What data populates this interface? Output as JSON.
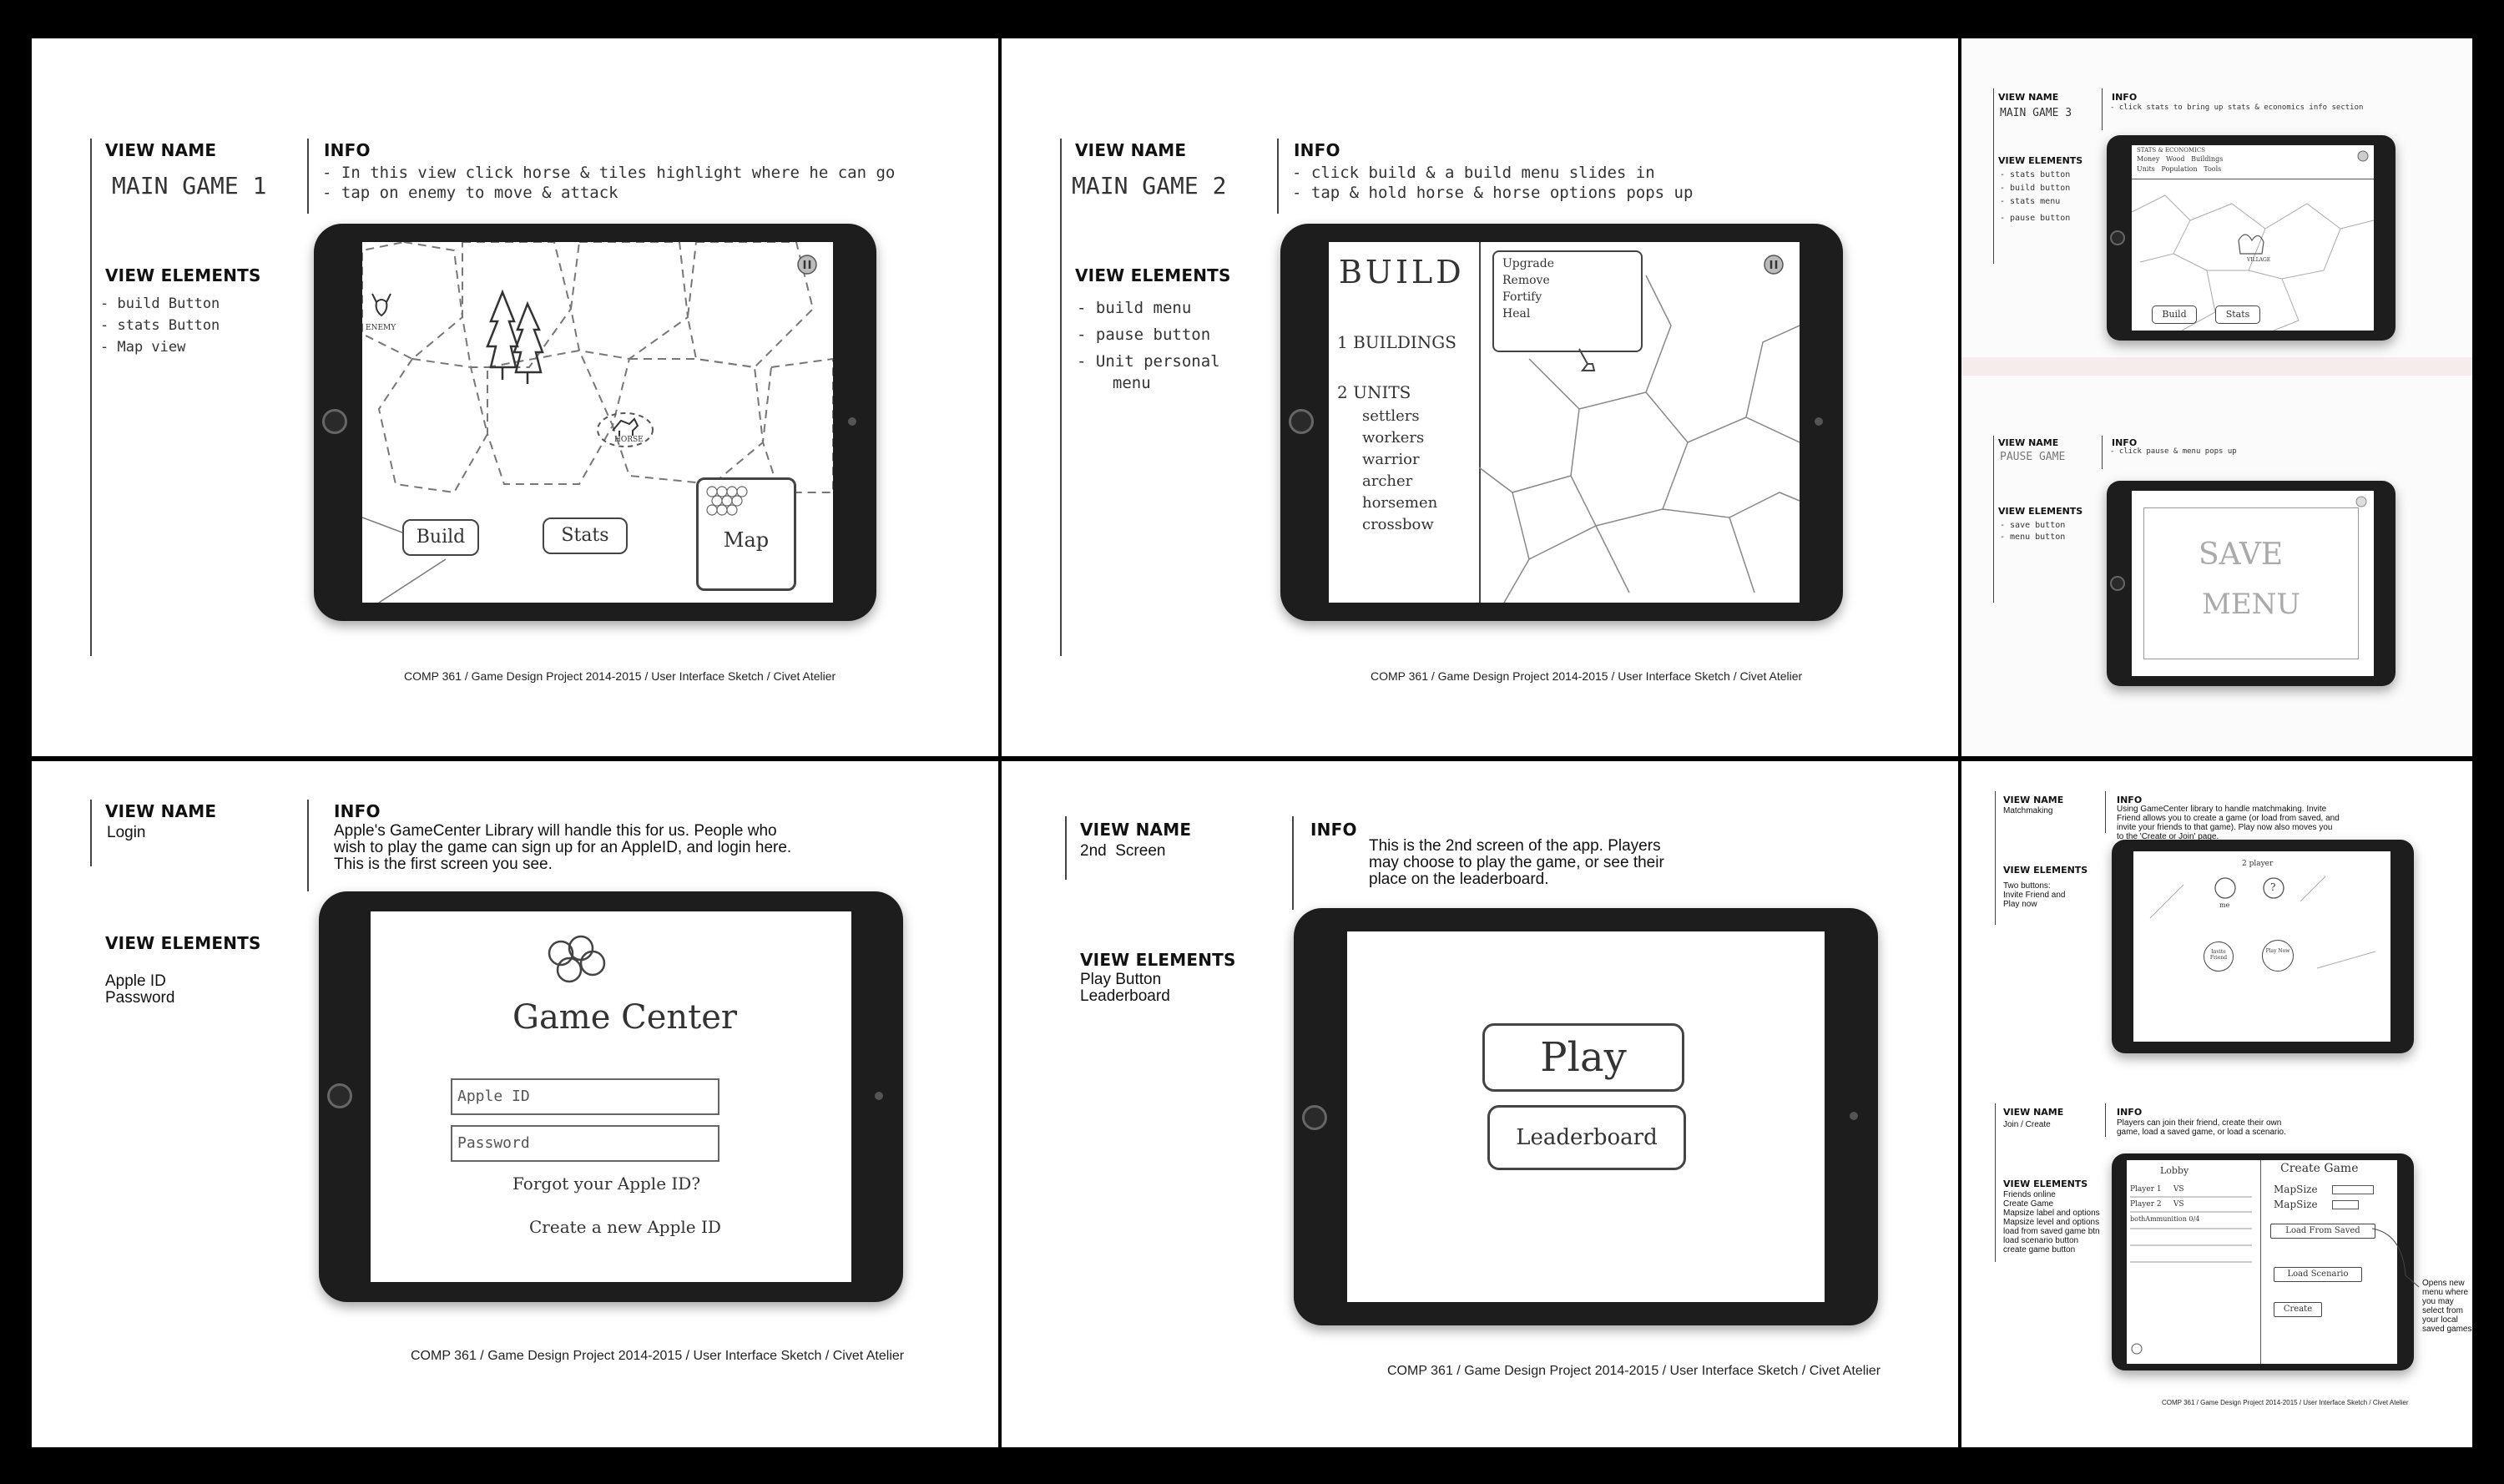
{
  "sheets": {
    "main_game_1": {
      "view_name_label": "VIEW NAME",
      "view_name": "MAIN GAME 1",
      "info_label": "INFO",
      "info_lines": [
        "- In this view click horse & tiles highlight where he can go",
        "- tap on enemy to move & attack"
      ],
      "view_elements_label": "VIEW ELEMENTS",
      "view_elements": [
        "- build Button",
        "- stats Button",
        "- Map view"
      ],
      "screen": {
        "enemy": "ENEMY",
        "horse": "HORSE",
        "build": "Build",
        "stats": "Stats",
        "map": "Map"
      },
      "footer": "COMP 361 / Game Design Project 2014-2015 / User Interface Sketch / Civet Atelier"
    },
    "main_game_2": {
      "view_name_label": "VIEW NAME",
      "view_name": "MAIN GAME 2",
      "info_label": "INFO",
      "info_lines": [
        "- click build & a build menu slides in",
        "- tap & hold horse & horse options pops up"
      ],
      "view_elements_label": "VIEW ELEMENTS",
      "view_elements": [
        "- build menu",
        "- pause button",
        "- Unit personal",
        "  menu"
      ],
      "screen": {
        "build_title": "BUILD",
        "buildings": "1 BUILDINGS",
        "units": "2 UNITS",
        "unit_list": [
          "settlers",
          "workers",
          "warrior",
          "archer",
          "horsemen",
          "crossbow"
        ],
        "popup": [
          "Upgrade",
          "Remove",
          "Fortify",
          "Heal"
        ]
      },
      "footer": "COMP 361 / Game Design Project 2014-2015 / User Interface Sketch / Civet Atelier"
    },
    "main_game_3": {
      "view_name_label": "VIEW NAME",
      "view_name": "MAIN GAME 3",
      "info_label": "INFO",
      "info_lines": [
        "- click stats to bring up stats & economics info section"
      ],
      "view_elements_label": "VIEW ELEMENTS",
      "view_elements": [
        "- stats button",
        "- build button",
        "- stats menu",
        "- pause button"
      ],
      "screen": {
        "stats_title": "STATS & ECONOMICS",
        "stats_row1": "Money   Wood   Buildings",
        "stats_row2": "Units   Population   Tools",
        "village": "VILLAGE",
        "build": "Build",
        "stats": "Stats"
      }
    },
    "pause_game": {
      "view_name_label": "VIEW NAME",
      "view_name": "PAUSE GAME",
      "info_label": "INFO",
      "info_lines": [
        "- click pause & menu pops up"
      ],
      "view_elements_label": "VIEW ELEMENTS",
      "view_elements": [
        "- save button",
        "- menu button"
      ],
      "screen": {
        "save": "SAVE",
        "menu": "MENU"
      }
    },
    "login": {
      "view_name_label": "VIEW NAME",
      "view_name": "Login",
      "info_label": "INFO",
      "info_lines": [
        "Apple's GameCenter Library will handle this for us. People who",
        "wish to play the game can sign up for an AppleID, and login here.",
        "This is the first screen you see."
      ],
      "view_elements_label": "VIEW ELEMENTS",
      "view_elements": [
        "Apple ID",
        "Password"
      ],
      "screen": {
        "title": "Game Center",
        "apple_id_placeholder": "Apple ID",
        "password_placeholder": "Password",
        "forgot": "Forgot your Apple ID?",
        "create": "Create a new Apple ID"
      },
      "footer": "COMP 361 / Game Design Project 2014-2015 / User Interface Sketch / Civet Atelier"
    },
    "second_screen": {
      "view_name_label": "VIEW NAME",
      "view_name": "2nd  Screen",
      "info_label": "INFO",
      "info_lines": [
        "This is the 2nd screen of the app. Players",
        "may choose to play the game, or see their",
        "place on the leaderboard."
      ],
      "view_elements_label": "VIEW ELEMENTS",
      "view_elements": [
        "Play Button",
        "Leaderboard"
      ],
      "screen": {
        "play": "Play",
        "leaderboard": "Leaderboard"
      },
      "footer": "COMP 361 / Game Design Project 2014-2015 / User Interface Sketch / Civet Atelier"
    },
    "matchmaking": {
      "view_name_label": "VIEW NAME",
      "view_name": "Matchmaking",
      "info_label": "INFO",
      "info_lines": [
        "Using GameCenter library to handle matchmaking. Invite",
        "Friend allows you to create a game (or load from saved, and",
        "invite your friends to that game). Play now also moves you",
        "to the 'Create or Join' page."
      ],
      "view_elements_label": "VIEW ELEMENTS",
      "view_elements": [
        "Two buttons:",
        "Invite Friend and",
        "Play now"
      ],
      "screen": {
        "title": "2 player",
        "me": "me",
        "opponent": "?",
        "invite": "Invite Friend",
        "play_now": "Play Now"
      }
    },
    "join_create": {
      "view_name_label": "VIEW NAME",
      "view_name": "Join / Create",
      "info_label": "INFO",
      "info_lines": [
        "Players can join their friend, create their own",
        "game, load a saved game, or load a scenario."
      ],
      "view_elements_label": "VIEW ELEMENTS",
      "view_elements": [
        "Friends online",
        "Create Game",
        "Mapsize label and options",
        "Mapsize level and options",
        "load from saved game btn",
        "load scenario button",
        "create game button"
      ],
      "screen": {
        "lobby": "Lobby",
        "create_game": "Create Game",
        "rows": [
          "Player 1     VS",
          "Player 2     VS",
          "bothAmmunition 0/4"
        ],
        "mapsize1": "MapSize",
        "mapsize2": "MapSize",
        "load_saved": "Load From Saved",
        "load_scenario": "Load Scenario",
        "create": "Create"
      },
      "annotation": [
        "Opens new",
        "menu where",
        "you may",
        "select from",
        "your local",
        "saved games"
      ],
      "footer": "COMP 361 / Game Design Project 2014-2015 / User Interface Sketch / Civet Atelier"
    }
  }
}
